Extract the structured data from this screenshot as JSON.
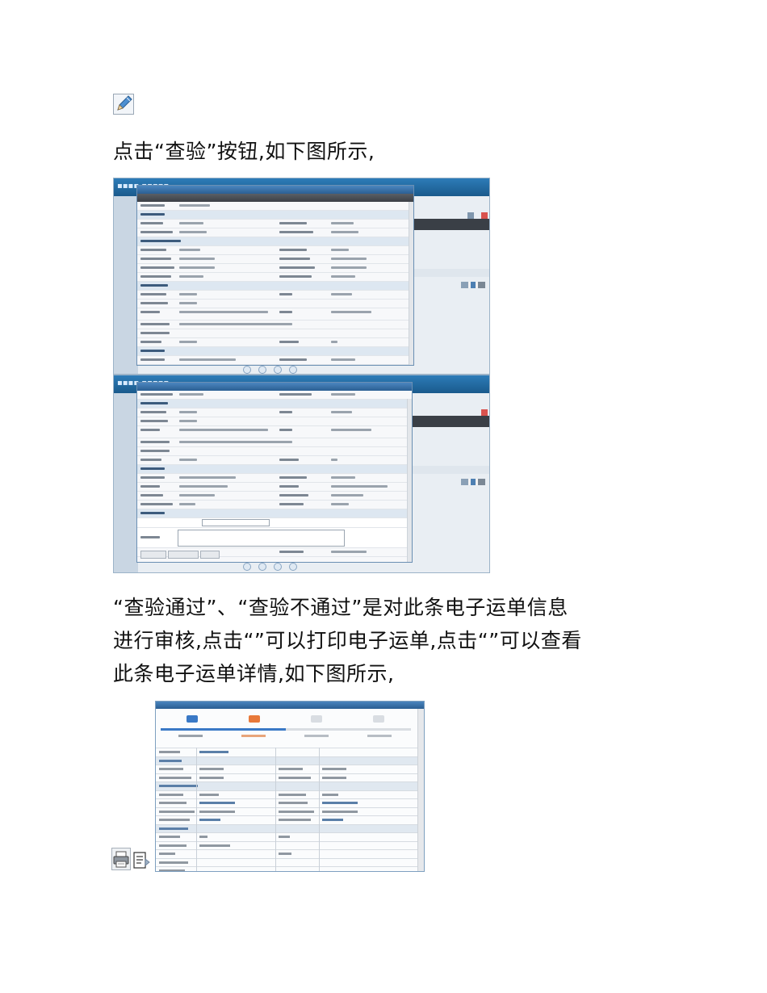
{
  "icons": {
    "edit": "pencil-icon",
    "print": "printer-icon",
    "detail": "document-detail-icon"
  },
  "paragraphs": {
    "p1": "点击“查验”按钮,如下图所示,",
    "p2_line1": "“查验通过”、“查验不通过”是对此条电子运单信息",
    "p2_line2": "进行审核,点击“”可以打印电子运单,点击“”可以查看",
    "p2_line3": "此条电子运单详情,如下图所示,"
  },
  "colors": {
    "app_blue": "#1f5f92",
    "dialog_title": "#2b5f93",
    "progress_orange": "#e8793a",
    "progress_blue": "#3a79c6"
  }
}
